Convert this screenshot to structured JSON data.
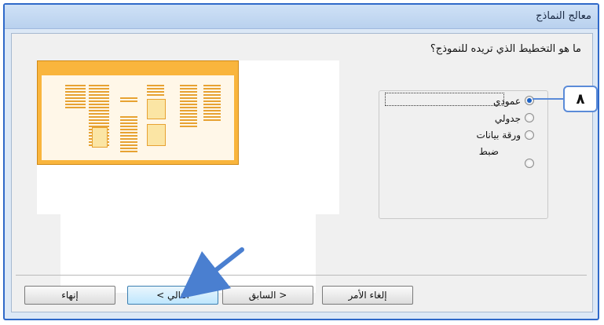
{
  "window": {
    "title": "معالج النماذج"
  },
  "wizard": {
    "question": "ما هو التخطيط الذي تريده للنموذج؟",
    "layout_options": [
      {
        "label": "عمودي",
        "selected": true
      },
      {
        "label": "جدولي",
        "selected": false
      },
      {
        "label": "ورقة بيانات",
        "selected": false
      },
      {
        "label": "ضبط",
        "selected": false
      }
    ]
  },
  "callout": {
    "label": "٨"
  },
  "buttons": {
    "cancel": "إلغاء الأمر",
    "back": "< السابق",
    "next": "التالي >",
    "finish": "إنهاء"
  },
  "colors": {
    "window_border": "#2f69c9",
    "preview_accent": "#f9b53d",
    "callout_border": "#5b8bd8",
    "selected_radio": "#1b62c6"
  }
}
